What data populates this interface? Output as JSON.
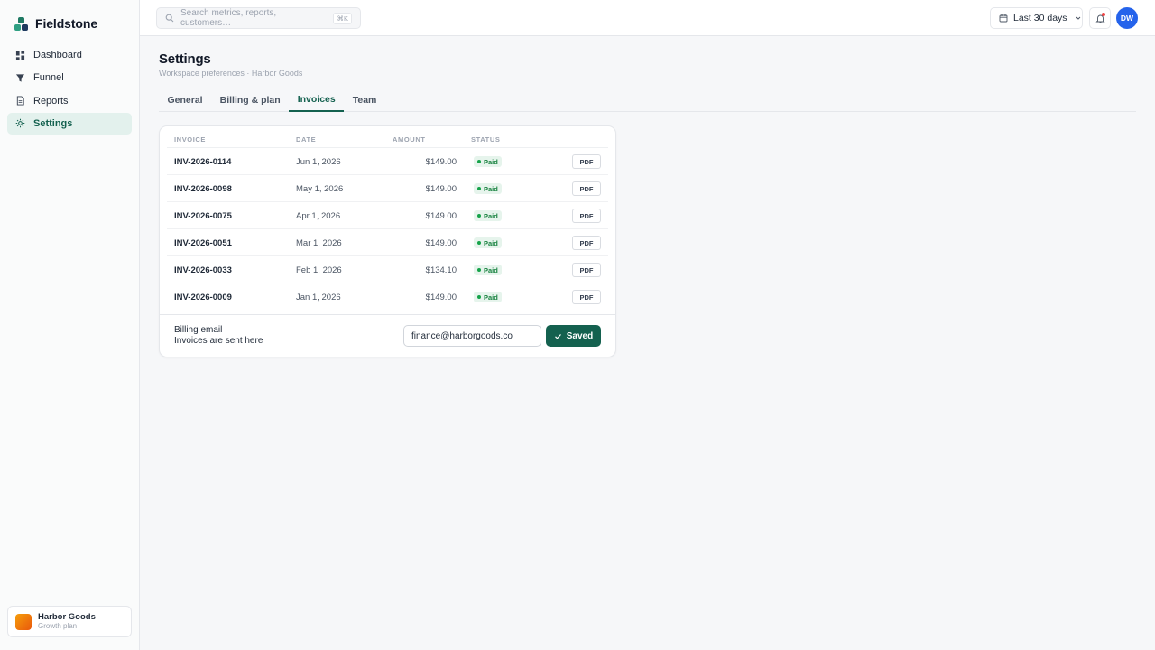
{
  "brand": {
    "name": "Fieldstone"
  },
  "sidebar": {
    "items": [
      {
        "label": "Dashboard",
        "icon": "dashboard-icon",
        "active": false
      },
      {
        "label": "Funnel",
        "icon": "funnel-icon",
        "active": false
      },
      {
        "label": "Reports",
        "icon": "document-icon",
        "active": false
      },
      {
        "label": "Settings",
        "icon": "gear-icon",
        "active": true
      }
    ],
    "workspace": {
      "name": "Harbor Goods",
      "plan": "Growth plan"
    }
  },
  "topbar": {
    "search_placeholder": "Search metrics, reports, customers…",
    "shortcut": "⌘K",
    "date_range": "Last 30 days",
    "avatar_initials": "DW"
  },
  "page": {
    "title": "Settings",
    "subtitle": "Workspace preferences · Harbor Goods"
  },
  "tabs": [
    {
      "label": "General",
      "active": false
    },
    {
      "label": "Billing & plan",
      "active": false
    },
    {
      "label": "Invoices",
      "active": true
    },
    {
      "label": "Team",
      "active": false
    }
  ],
  "invoices": {
    "headers": {
      "invoice": "INVOICE",
      "date": "DATE",
      "amount": "AMOUNT",
      "status": "STATUS"
    },
    "rows": [
      {
        "id": "INV-2026-0114",
        "date": "Jun 1, 2026",
        "amount": "$149.00",
        "status": "Paid",
        "action": "PDF"
      },
      {
        "id": "INV-2026-0098",
        "date": "May 1, 2026",
        "amount": "$149.00",
        "status": "Paid",
        "action": "PDF"
      },
      {
        "id": "INV-2026-0075",
        "date": "Apr 1, 2026",
        "amount": "$149.00",
        "status": "Paid",
        "action": "PDF"
      },
      {
        "id": "INV-2026-0051",
        "date": "Mar 1, 2026",
        "amount": "$149.00",
        "status": "Paid",
        "action": "PDF"
      },
      {
        "id": "INV-2026-0033",
        "date": "Feb 1, 2026",
        "amount": "$134.10",
        "status": "Paid",
        "action": "PDF"
      },
      {
        "id": "INV-2026-0009",
        "date": "Jan 1, 2026",
        "amount": "$149.00",
        "status": "Paid",
        "action": "PDF"
      }
    ]
  },
  "billing_email": {
    "label": "Billing email",
    "hint": "Invoices are sent here",
    "value": "finance@harborgoods.co",
    "button": "Saved"
  },
  "colors": {
    "accent": "#14614f",
    "accent_bg": "#e3f1ed",
    "paid_green": "#15803d",
    "avatar_blue": "#2563eb"
  }
}
